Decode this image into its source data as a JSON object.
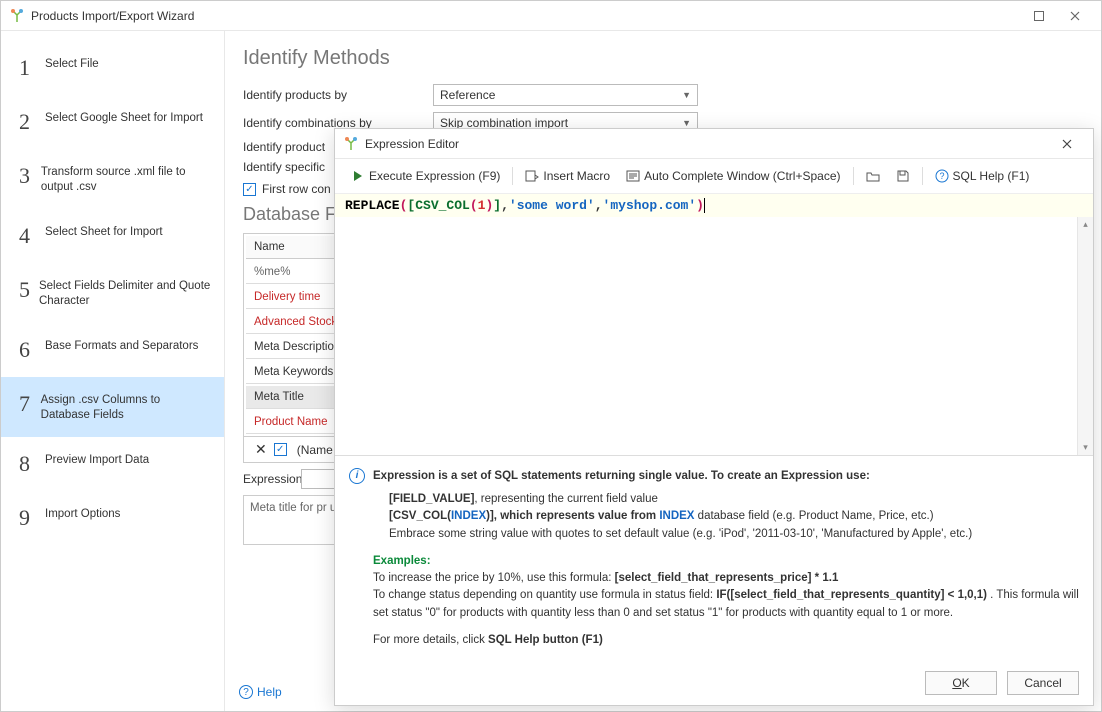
{
  "window": {
    "title": "Products Import/Export Wizard",
    "maximize": "□",
    "close": "✕"
  },
  "steps": [
    {
      "num": "1",
      "label": "Select File"
    },
    {
      "num": "2",
      "label": "Select Google Sheet for Import"
    },
    {
      "num": "3",
      "label": "Transform source .xml file to output .csv"
    },
    {
      "num": "4",
      "label": "Select Sheet for Import"
    },
    {
      "num": "5",
      "label": "Select Fields Delimiter and Quote Character"
    },
    {
      "num": "6",
      "label": "Base Formats and Separators"
    },
    {
      "num": "7",
      "label": "Assign .csv Columns to Database Fields"
    },
    {
      "num": "8",
      "label": "Preview Import Data"
    },
    {
      "num": "9",
      "label": "Import Options"
    }
  ],
  "activeStepIndex": 6,
  "identify": {
    "heading": "Identify Methods",
    "productsBy": {
      "label": "Identify products by",
      "value": "Reference"
    },
    "combinationsBy": {
      "label": "Identify combinations by",
      "value": "Skip combination import"
    },
    "productLine": "Identify product",
    "specificLine": "Identify specific",
    "firstRow": "First row con"
  },
  "dbSection": {
    "heading": "Database F",
    "nameHeader": "Name",
    "filter": "%me%",
    "rows": [
      {
        "text": "Delivery time",
        "red": true
      },
      {
        "text": "Advanced Stock",
        "red": true
      },
      {
        "text": "Meta Description",
        "red": false
      },
      {
        "text": "Meta Keywords",
        "red": false
      },
      {
        "text": "Meta Title",
        "red": false,
        "selected": true
      },
      {
        "text": "Product Name",
        "red": true
      }
    ],
    "subrowText": "(Name",
    "expressionLabel": "Expression",
    "hint": "Meta title for pr\nunique title"
  },
  "footer": {
    "help": "Help"
  },
  "modal": {
    "title": "Expression Editor",
    "toolbar": {
      "execute": "Execute Expression (F9)",
      "insertMacro": "Insert Macro",
      "autoComplete": "Auto Complete Window (Ctrl+Space)",
      "sqlHelp": "SQL Help (F1)"
    },
    "expression": {
      "fn": "REPLACE",
      "p1": "(",
      "col_open": "[CSV_COL",
      "col_p1": "(",
      "col_num": "1",
      "col_p2": ")",
      "col_close": "]",
      "comma1": ",",
      "str1": "'some word'",
      "comma2": ",",
      "str2": "'myshop.com'",
      "p2": ")"
    },
    "help": {
      "line1": "Expression is a set of SQL statements returning single value. To create an Expression use:",
      "fvBold": "[FIELD_VALUE]",
      "fvRest": ", representing the current field value",
      "csvPre": "[CSV_COL(",
      "csvIndex": "INDEX",
      "csvMid": ")], which represents value from ",
      "csvIndex2": "INDEX",
      "csvRest": " database field (e.g. Product Name, Price, etc.)",
      "embrace": "Embrace some string value with quotes to set default value (e.g. 'iPod', '2011-03-10', 'Manufactured by Apple', etc.)",
      "examples": "Examples:",
      "ex1pre": "    To increase the price by 10%, use this formula: ",
      "ex1bold": "[select_field_that_represents_price] * 1.1",
      "ex2pre": "    To change status depending on quantity use formula in status field: ",
      "ex2bold": "IF([select_field_that_represents_quantity] < 1,0,1)",
      "ex2rest": " . This formula will set status \"0\" for products with quantity less than 0 and set status \"1\" for products with quantity equal to 1 or more.",
      "detailsPre": "For more details, click ",
      "detailsBold": "SQL Help button (F1)"
    },
    "buttons": {
      "ok": "OK",
      "cancel": "Cancel"
    }
  }
}
